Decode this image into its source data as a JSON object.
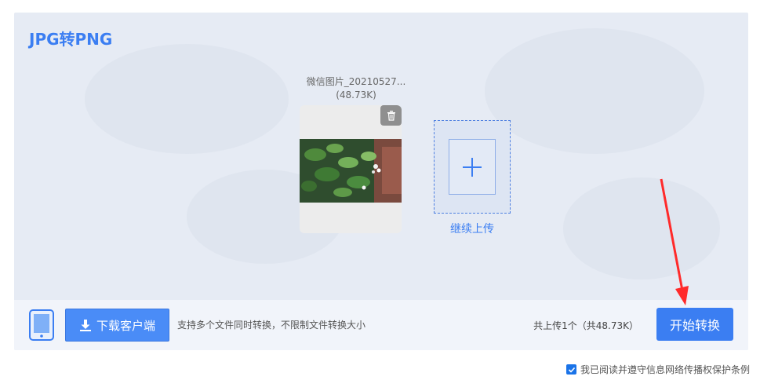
{
  "tool": {
    "title": "JPG转PNG"
  },
  "file": {
    "name": "微信图片_20210527...",
    "size": "(48.73K)"
  },
  "upload_more": {
    "label": "继续上传"
  },
  "toolbar": {
    "download_label": "下载客户端",
    "hint": "支持多个文件同时转换，不限制文件转换大小",
    "count": "共上传1个（共48.73K）",
    "start_label": "开始转换"
  },
  "agreement": {
    "label": "我已阅读并遵守信息网络传播权保护条例",
    "checked": true
  },
  "colors": {
    "accent": "#3b7ef2",
    "annotation_arrow": "#ff2a2a"
  },
  "icons": [
    "trash-icon",
    "plus-icon",
    "tablet-icon",
    "download-icon",
    "check-icon",
    "annotation-arrow"
  ]
}
